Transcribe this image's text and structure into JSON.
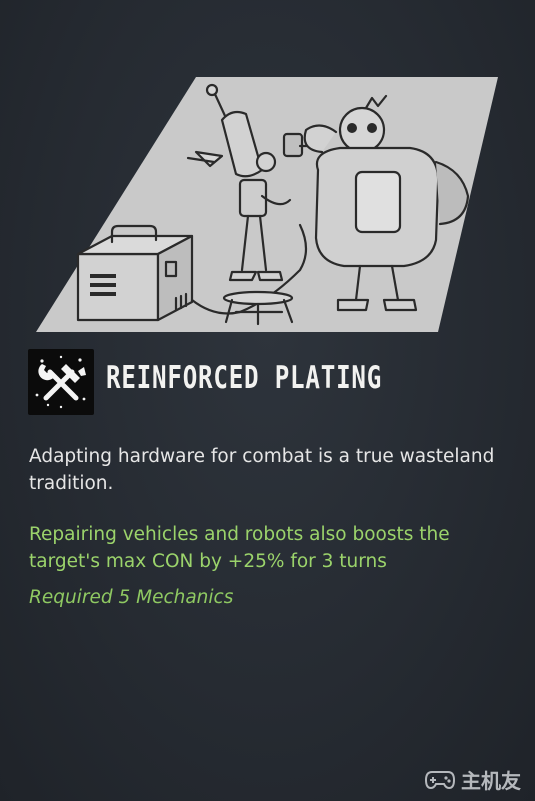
{
  "perk": {
    "icon": "wrench-hammer-icon",
    "title": "REINFORCED PLATING",
    "description": "Adapting hardware for combat is a true wasteland tradition.",
    "effect": "Repairing vehicles and robots also boosts the target's max CON by +25% for 3 turns",
    "requirement": "Required 5 Mechanics"
  },
  "illustration": {
    "subject": "robot-repair-illustration"
  },
  "watermark": {
    "icon": "gamepad-icon",
    "text": "主机友"
  },
  "colors": {
    "background": "#262b32",
    "title": "#f2f2f0",
    "description": "#e6e6e6",
    "effect": "#9bd36b",
    "requirement": "#8fc962",
    "illustration_fill": "#c8c8c8"
  }
}
